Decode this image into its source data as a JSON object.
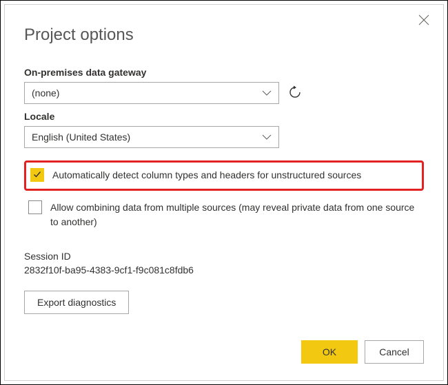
{
  "title": "Project options",
  "gateway": {
    "label": "On-premises data gateway",
    "value": "(none)"
  },
  "locale": {
    "label": "Locale",
    "value": "English (United States)"
  },
  "checks": {
    "autodetect": "Automatically detect column types and headers for unstructured sources",
    "combine": "Allow combining data from multiple sources (may reveal private data from one source to another)"
  },
  "session": {
    "label": "Session ID",
    "id": "2832f10f-ba95-4383-9cf1-f9c081c8fdb6"
  },
  "buttons": {
    "export": "Export diagnostics",
    "ok": "OK",
    "cancel": "Cancel"
  }
}
